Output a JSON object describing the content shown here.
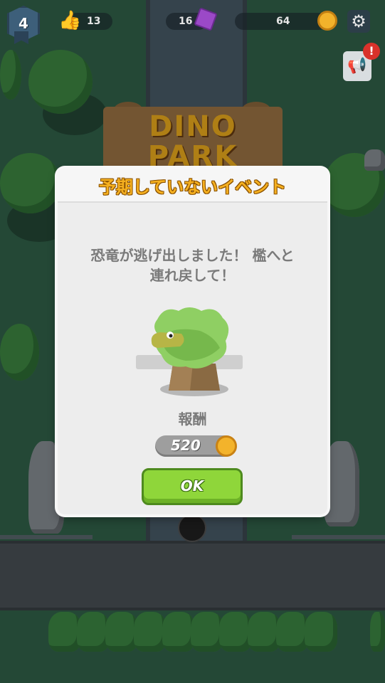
{
  "hud": {
    "level": "4",
    "likes": "13",
    "gems": "16",
    "coins": "64",
    "alert_badge": "!"
  },
  "park_sign": {
    "line1": "DINO",
    "line2": "PARK"
  },
  "dialog": {
    "title": "予期していないイベント",
    "message": "恐竜が逃げ出しました！ 檻へと\n連れ戻して！",
    "reward_label": "報酬",
    "reward_value": "520",
    "ok_label": "OK"
  },
  "icons": {
    "level_badge": "level-badge-icon",
    "likes": "thumbs-up-icon",
    "gems": "purple-gem-icon",
    "coins": "gold-coin-icon",
    "settings": "gear-icon",
    "announcement": "megaphone-icon",
    "escaped_dino": "camouflaged-dinosaur-tree-icon"
  },
  "colors": {
    "title_gold": "#f5b020",
    "ok_green": "#8fd63a",
    "alert_red": "#d9322b",
    "dialog_bg": "#ededed"
  }
}
